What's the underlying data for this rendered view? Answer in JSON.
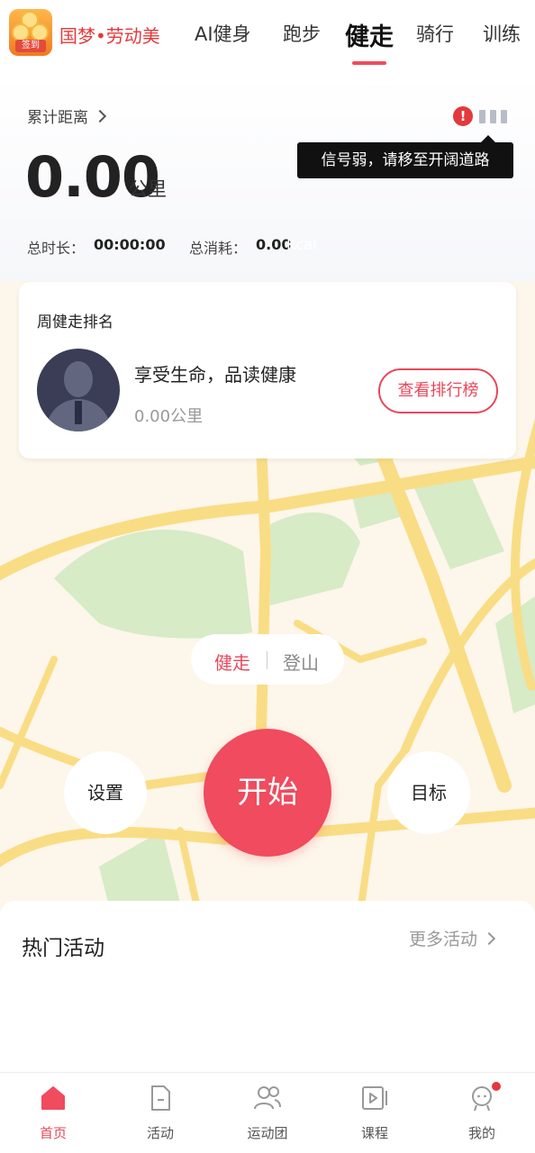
{
  "header": {
    "sign_badge": "签到",
    "brand": "国梦•劳动美",
    "tabs": [
      {
        "label": "AI健身",
        "active": false
      },
      {
        "label": "跑步",
        "active": false
      },
      {
        "label": "健走",
        "active": true
      },
      {
        "label": "骑行",
        "active": false
      },
      {
        "label": "训练",
        "active": false
      }
    ]
  },
  "stats": {
    "cumulative_label": "累计距离",
    "distance_value": "0.00",
    "distance_unit": "公里",
    "duration_label": "总时长：",
    "duration_value": "00:00:00",
    "calorie_label": "总消耗：",
    "calorie_value": "0.00",
    "calorie_unit": "Kcal"
  },
  "signal": {
    "alert_glyph": "!",
    "tooltip": "信号弱，请移至开阔道路"
  },
  "ranking": {
    "title": "周健走排名",
    "user_name": "享受生命，品读健康",
    "user_distance": "0.00公里",
    "button": "查看排行榜"
  },
  "mode": {
    "walk": "健走",
    "hike": "登山"
  },
  "controls": {
    "settings": "设置",
    "start": "开始",
    "goal": "目标"
  },
  "hot_activities": {
    "title": "热门活动",
    "more": "更多活动"
  },
  "bottom_nav": [
    {
      "label": "首页",
      "icon": "home-icon",
      "active": true
    },
    {
      "label": "活动",
      "icon": "activity-icon",
      "active": false
    },
    {
      "label": "运动团",
      "icon": "group-icon",
      "active": false
    },
    {
      "label": "课程",
      "icon": "course-icon",
      "active": false
    },
    {
      "label": "我的",
      "icon": "profile-icon",
      "active": false
    }
  ],
  "colors": {
    "accent": "#f04b5e",
    "alert": "#e4393c",
    "map_bg": "#fdf6ea",
    "map_road": "#f9dd85",
    "map_green": "#d7ebc6"
  }
}
